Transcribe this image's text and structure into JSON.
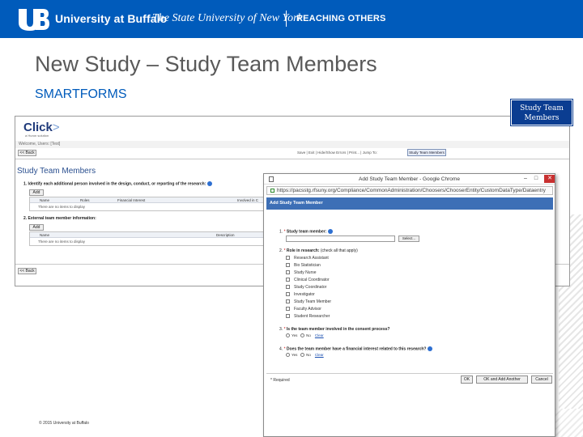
{
  "banner": {
    "name": "University at Buffalo",
    "tagline": "The State University of New York",
    "motto": "REACHING OTHERS",
    "color": "#005bbb"
  },
  "slide": {
    "title": "New Study – Study Team Members",
    "subtitle": "SMARTFORMS",
    "callout": "Study Team Members",
    "footer": "© 2015 University at Buffalo"
  },
  "screenshot": {
    "logo": "Click",
    "logo_sub": "a Huron solution",
    "user_line": "Welcome, Users: [Test]",
    "back_label": "<< Back",
    "crumbs": "Save | Exit | Hide/Show Errors | Print...  | Jump To:",
    "crumb_active": "Study Team Members",
    "section_title": "Study Team Members",
    "q1": "1. Identify each additional person involved in the design, conduct, or reporting of the research:",
    "q2": "2. External team member information:",
    "add_label": "Add",
    "grid1_cols": [
      "Name",
      "Roles",
      "Financial Interest",
      "Involved in C"
    ],
    "grid2_cols": [
      "Name",
      "Description"
    ],
    "empty": "There are no items to display"
  },
  "dialog": {
    "window_title": "Add Study Team Member - Google Chrome",
    "url": "https://pacsstg.rfsuny.org/Compliance/CommonAdministration/Choosers/ChooserEntity/CustomDataType/Dataentry",
    "header": "Add Study Team Member",
    "q1_num": "1.",
    "q1_label": "Study team member:",
    "select_label": "Select...",
    "q2_num": "2.",
    "q2_label": "Role in research:",
    "q2_hint": "(check all that apply)",
    "roles": [
      "Research Assistant",
      "Bio Statistician",
      "Study Nurse",
      "Clinical Coordinator",
      "Study Coordinator",
      "Investigator",
      "Study Team Member",
      "Faculty Advisor",
      "Student Researcher"
    ],
    "q3_num": "3.",
    "q3_label": "Is the team member involved in the consent process?",
    "q4_num": "4.",
    "q4_label": "Does the team member have a financial interest related to this research?",
    "yes": "Yes",
    "no": "No",
    "clear": "Clear",
    "required_note": "* Required",
    "ok": "OK",
    "ok_add": "OK and Add Another",
    "cancel": "Cancel"
  }
}
